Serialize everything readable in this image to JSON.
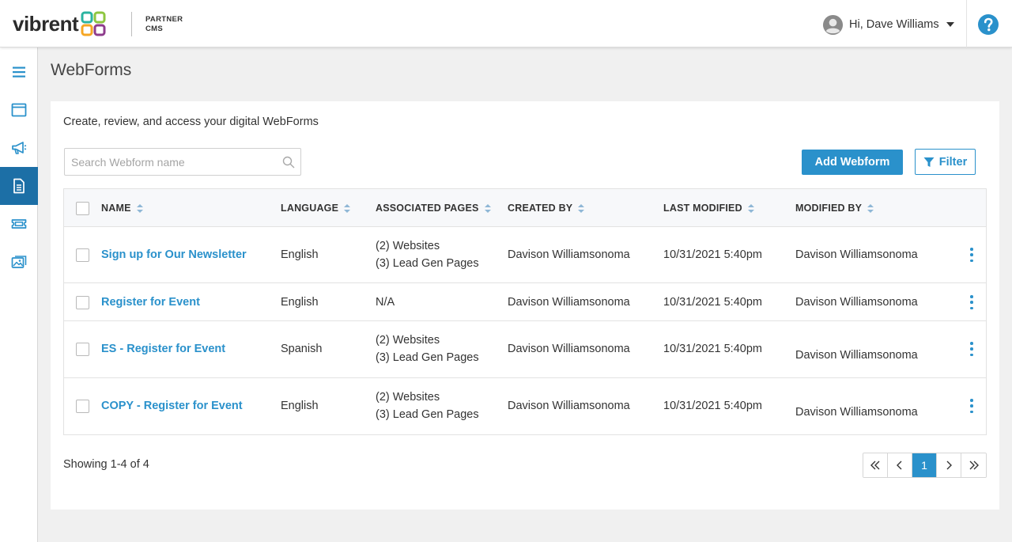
{
  "header": {
    "logo_text": "vibrent",
    "logo_sub_line1": "PARTNER",
    "logo_sub_line2": "CMS",
    "user_greeting": "Hi, Dave Williams"
  },
  "sidebar": {
    "items": [
      {
        "icon": "hamburger-menu-icon",
        "active": false
      },
      {
        "icon": "browser-window-icon",
        "active": false
      },
      {
        "icon": "megaphone-icon",
        "active": false
      },
      {
        "icon": "document-icon",
        "active": true
      },
      {
        "icon": "ticket-icon",
        "active": false
      },
      {
        "icon": "image-gallery-icon",
        "active": false
      }
    ]
  },
  "page": {
    "title": "WebForms",
    "subtitle": "Create, review, and access your digital WebForms"
  },
  "search": {
    "placeholder": "Search Webform name",
    "value": ""
  },
  "toolbar": {
    "add_label": "Add Webform",
    "filter_label": "Filter"
  },
  "table": {
    "columns": [
      "NAME",
      "LANGUAGE",
      "ASSOCIATED PAGES",
      "CREATED BY",
      "LAST MODIFIED",
      "MODIFIED BY"
    ],
    "rows": [
      {
        "name": "Sign up for Our Newsletter",
        "language": "English",
        "pages_line1": "(2) Websites",
        "pages_line2": "(3) Lead Gen Pages",
        "created_by": "Davison Williamsonoma",
        "last_modified": "10/31/2021 5:40pm",
        "modified_by": "Davison Williamsonoma"
      },
      {
        "name": "Register for Event",
        "language": "English",
        "pages_line1": "N/A",
        "pages_line2": "",
        "created_by": "Davison Williamsonoma",
        "last_modified": "10/31/2021 5:40pm",
        "modified_by": "Davison Williamsonoma"
      },
      {
        "name": "ES - Register for Event",
        "language": "Spanish",
        "pages_line1": "(2) Websites",
        "pages_line2": "(3) Lead Gen Pages",
        "created_by": "Davison Williamsonoma",
        "last_modified": "10/31/2021 5:40pm",
        "modified_by": "Davison Williamsonoma"
      },
      {
        "name": "COPY - Register for Event",
        "language": "English",
        "pages_line1": "(2) Websites",
        "pages_line2": "(3) Lead Gen Pages",
        "created_by": "Davison Williamsonoma",
        "last_modified": "10/31/2021 5:40pm",
        "modified_by": "Davison Williamsonoma"
      }
    ]
  },
  "footer": {
    "showing": "Showing 1-4 of 4",
    "current_page": "1"
  },
  "colors": {
    "accent": "#2a91cb",
    "sidebar_active": "#1c6fa6"
  }
}
